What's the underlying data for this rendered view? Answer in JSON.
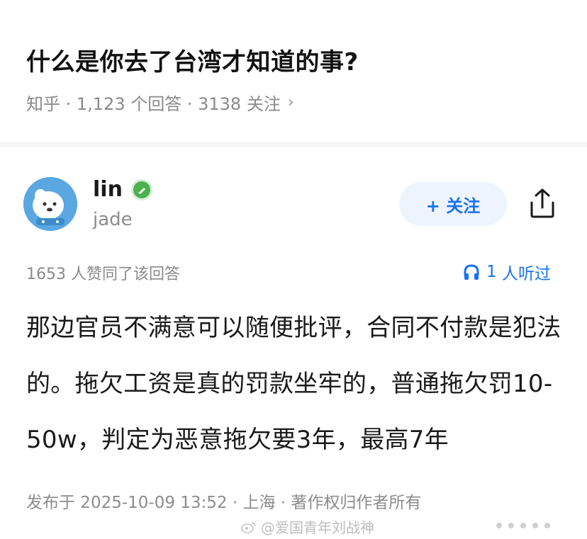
{
  "question": {
    "title": "什么是你去了台湾才知道的事?",
    "meta": "知乎 · 1,123  个回答 · 3138  关注",
    "chevron_icon": "chevron-right-icon"
  },
  "author": {
    "name": "lin",
    "handle": "jade",
    "badge_icon": "verified-badge-icon",
    "badge_color": "#4caf50"
  },
  "actions": {
    "follow_label": "+ 关注",
    "share_icon": "share-icon",
    "accent_color": "#1772f6"
  },
  "stats": {
    "likes_text": "1653  人赞同了该回答",
    "listen_count": "1",
    "listen_suffix": " 人听过"
  },
  "answer": {
    "body": "那边官员不满意可以随便批评，合同不付款是犯法的。拖欠工资是真的罚款坐牢的，普通拖欠罚10-50w，判定为恶意拖欠要3年，最高7年"
  },
  "footer": {
    "publish_info": "发布于  2025-10-09  13:52 · 上海 · 著作权归作者所有",
    "watermark": "@爱国青年刘战神"
  }
}
